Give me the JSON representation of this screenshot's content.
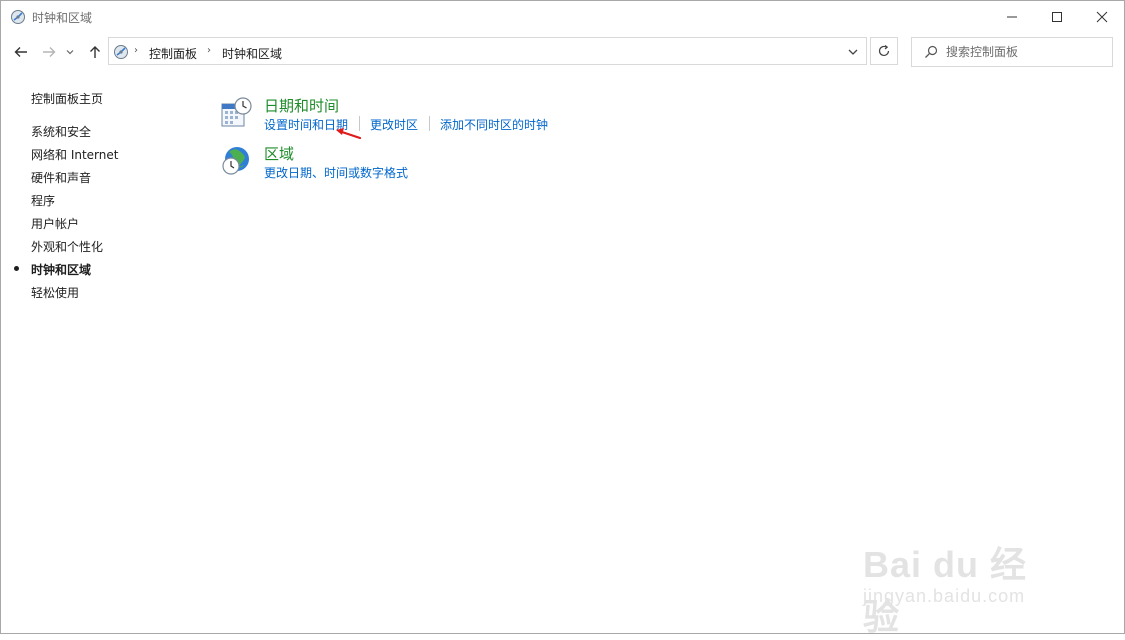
{
  "window": {
    "title": "时钟和区域"
  },
  "address_bar": {
    "breadcrumbs": [
      "控制面板",
      "时钟和区域"
    ]
  },
  "search": {
    "placeholder": "搜索控制面板"
  },
  "sidebar": {
    "items": [
      {
        "label": "控制面板主页",
        "current": false
      },
      {
        "label": "系统和安全",
        "current": false
      },
      {
        "label": "网络和 Internet",
        "current": false
      },
      {
        "label": "硬件和声音",
        "current": false
      },
      {
        "label": "程序",
        "current": false
      },
      {
        "label": "用户帐户",
        "current": false
      },
      {
        "label": "外观和个性化",
        "current": false
      },
      {
        "label": "时钟和区域",
        "current": true
      },
      {
        "label": "轻松使用",
        "current": false
      }
    ]
  },
  "categories": [
    {
      "title": "日期和时间",
      "icon": "calendar-clock-icon",
      "links": [
        "设置时间和日期",
        "更改时区",
        "添加不同时区的时钟"
      ]
    },
    {
      "title": "区域",
      "icon": "globe-clock-icon",
      "links": [
        "更改日期、时间或数字格式"
      ]
    }
  ],
  "watermark": {
    "brand": "Bai du 经验",
    "url": "jingyan.baidu.com"
  },
  "colors": {
    "category_title": "#1e8c2a",
    "link": "#0066cc",
    "annotation_arrow": "#e01b1b"
  }
}
